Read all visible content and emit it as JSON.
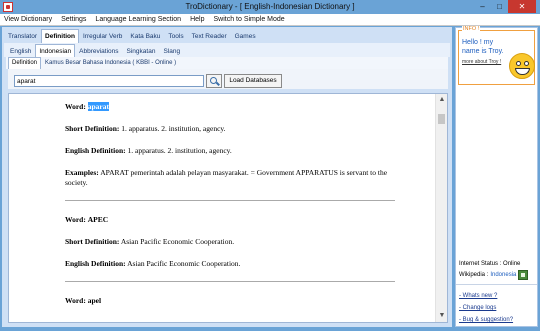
{
  "window": {
    "title": "TroDictionary - [ English-Indonesian Dictionary ]",
    "buttons": [
      "–",
      "□",
      "✕"
    ]
  },
  "menu": [
    "View Dictionary",
    "Settings",
    "Language Learning Section",
    "Help",
    "Switch to Simple Mode"
  ],
  "tabs_main": [
    "Translator",
    "Definition",
    "Irregular Verb",
    "Kata Baku",
    "Tools",
    "Text Reader",
    "Games"
  ],
  "tabs_lang": [
    "English",
    "Indonesian",
    "Abbreviations",
    "Singkatan",
    "Slang"
  ],
  "tabs_def": [
    "Definition",
    "Kamus Besar Bahasa Indonesia ( KBBI - Online )"
  ],
  "search": {
    "value": "aparat",
    "load_label": "Load Databases"
  },
  "entries": [
    {
      "word_label": "Word:",
      "word": "aparat",
      "short_label": "Short Definition:",
      "short": "1. apparatus. 2. institution, agency.",
      "english_label": "English Definition:",
      "english": "1. apparatus. 2. institution, agency.",
      "examples_label": "Examples:",
      "examples": "APARAT pemerintah adalah pelayan masyarakat. = Government APPARATUS is servant to the society."
    },
    {
      "word_label": "Word:",
      "word": "APEC",
      "short_label": "Short Definition:",
      "short": "Asian Pacific Economic Cooperation.",
      "english_label": "English Definition:",
      "english": "Asian Pacific Economic Cooperation."
    },
    {
      "word_label": "Word:",
      "word": "apel"
    }
  ],
  "sidebar": {
    "info_title": "INFO !",
    "info_text": "Hello ! my name is Troy.",
    "info_link": "more about Troy !",
    "status": "Internet Status : Online",
    "wiki_label": "Wikipedia :",
    "wiki_value": "Indonesia",
    "links": [
      "- Whats new ?",
      "- Change logs",
      "- Bug & suggestion?"
    ]
  },
  "colors": {
    "titlebar": "#6aa3d6",
    "highlight": "#3399ff",
    "close": "#c7372f"
  }
}
